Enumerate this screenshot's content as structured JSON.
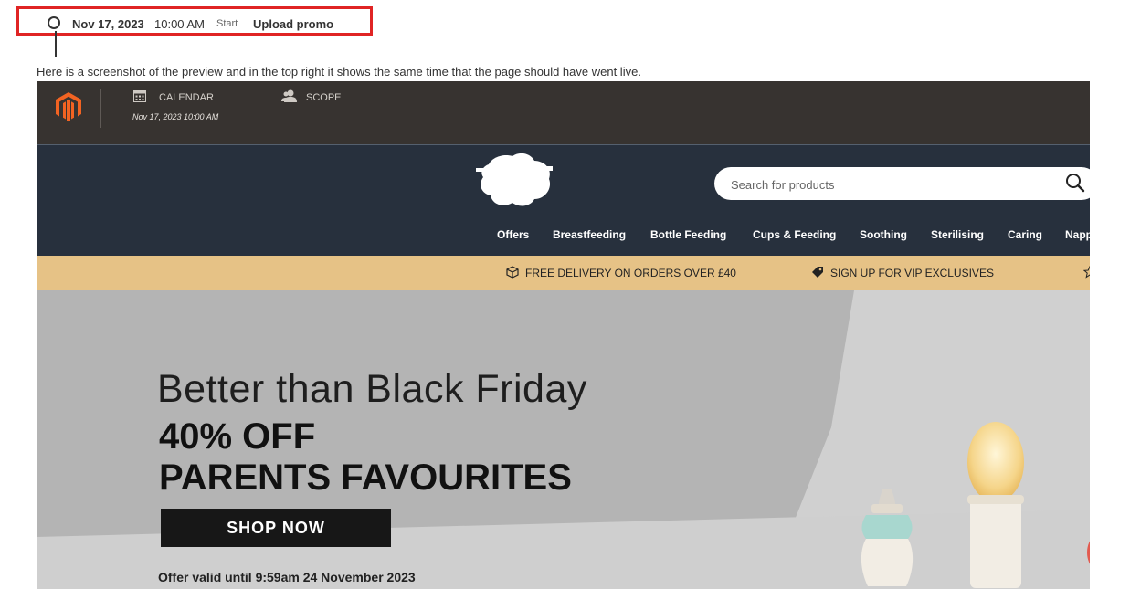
{
  "timeline": {
    "date": "Nov 17, 2023",
    "time": "10:00 AM",
    "status": "Start",
    "event": "Upload promo"
  },
  "caption": "Here is a screenshot of the preview and in the top right it shows the same time that the page should have went live.",
  "admin_bar": {
    "calendar_label": "CALENDAR",
    "calendar_value": "Nov 17, 2023 10:00 AM",
    "scope_label": "SCOPE"
  },
  "search": {
    "placeholder": "Search for products"
  },
  "nav": {
    "items": [
      "Offers",
      "Breastfeeding",
      "Bottle Feeding",
      "Cups & Feeding",
      "Soothing",
      "Sterilising",
      "Caring",
      "Napp"
    ]
  },
  "promo_strip": {
    "delivery": "FREE DELIVERY ON ORDERS OVER £40",
    "vip": "SIGN UP FOR VIP EXCLUSIVES"
  },
  "hero": {
    "title": "Better than Black Friday",
    "subtitle_line1": "40% OFF",
    "subtitle_line2": "PARENTS FAVOURITES",
    "cta": "SHOP NOW",
    "offer": "Offer valid until 9:59am 24 November 2023"
  },
  "colors": {
    "highlight_border": "#e02424",
    "admin_bar": "#373330",
    "header": "#27303d",
    "promo_strip": "#e6c286",
    "magento_orange": "#f26322"
  }
}
